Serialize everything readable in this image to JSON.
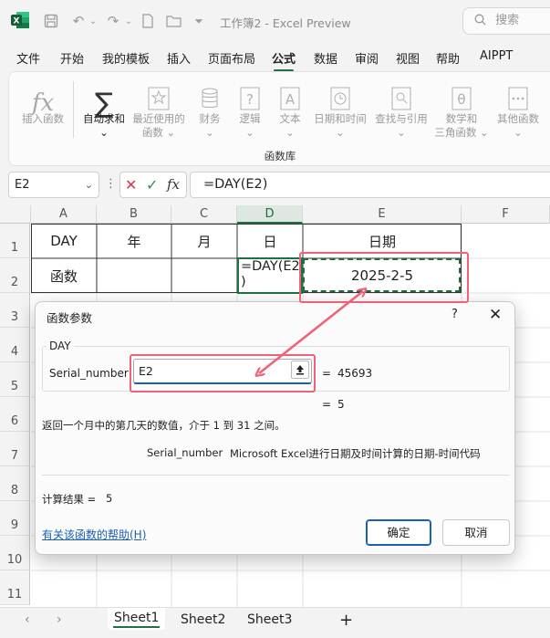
{
  "title_bar": {
    "app_icon": "excel-logo",
    "document_title": "工作簿2 - Excel Preview",
    "search_placeholder": "搜索"
  },
  "menu": {
    "tabs": [
      "文件",
      "开始",
      "我的模板",
      "插入",
      "页面布局",
      "公式",
      "数据",
      "审阅",
      "视图",
      "帮助",
      "AIPPT"
    ],
    "active_tab": "公式"
  },
  "ribbon": {
    "buttons": [
      {
        "label": "插入函数",
        "sub": "",
        "icon": "fx-icon",
        "enabled": false
      },
      {
        "label": "自动求和",
        "sub": "⌄",
        "icon": "sigma-icon",
        "enabled": true
      },
      {
        "label": "最近使用的",
        "sub": "函数 ⌄",
        "icon": "star-icon",
        "enabled": false
      },
      {
        "label": "财务",
        "sub": "⌄",
        "icon": "coins-icon",
        "enabled": false
      },
      {
        "label": "逻辑",
        "sub": "⌄",
        "icon": "question-icon",
        "enabled": false
      },
      {
        "label": "文本",
        "sub": "⌄",
        "icon": "text-a-icon",
        "enabled": false
      },
      {
        "label": "日期和时间",
        "sub": "⌄",
        "icon": "clock-icon",
        "enabled": false
      },
      {
        "label": "查找与引用",
        "sub": "⌄",
        "icon": "search-doc-icon",
        "enabled": false
      },
      {
        "label": "数学和",
        "sub": "三角函数 ⌄",
        "icon": "theta-icon",
        "enabled": false
      },
      {
        "label": "其他函数",
        "sub": "⌄",
        "icon": "more-icon",
        "enabled": false
      }
    ],
    "group_label": "函数库"
  },
  "formula_bar": {
    "name_box": "E2",
    "formula": "=DAY(E2)"
  },
  "grid": {
    "columns": [
      "A",
      "B",
      "C",
      "D",
      "E",
      "F"
    ],
    "selected_column": "D",
    "rows": [
      "1",
      "2",
      "3",
      "4",
      "5",
      "6",
      "7",
      "8",
      "9",
      "10",
      "11"
    ],
    "cells": {
      "A1": "DAY",
      "B1": "年",
      "C1": "月",
      "D1": "日",
      "E1": "日期",
      "A2": "函数",
      "D2": "=DAY(E2\n)",
      "E2": "2025-2-5"
    }
  },
  "dialog": {
    "title": "函数参数",
    "help_glyph": "?",
    "close_glyph": "✕",
    "function_name": "DAY",
    "arg_label": "Serial_number",
    "arg_value": "E2",
    "arg_eq": "=",
    "arg_result": "45693",
    "result_eq": "=",
    "result_value": "5",
    "description": "返回一个月中的第几天的数值，介于 1 到 31 之间。",
    "arg_desc_name": "Serial_number",
    "arg_desc": "Microsoft Excel进行日期及时间计算的日期-时间代码",
    "calc_label": "计算结果 =",
    "calc_value": "5",
    "help_link": "有关该函数的帮助(H)",
    "ok": "确定",
    "cancel": "取消"
  },
  "sheets": {
    "tabs": [
      "Sheet1",
      "Sheet2",
      "Sheet3"
    ],
    "active": "Sheet1",
    "add": "+"
  },
  "colors": {
    "accent_green": "#1e7145",
    "highlight": "#f0617a",
    "link_blue": "#1a5fb4",
    "marching_ants": "#1e6b40"
  }
}
